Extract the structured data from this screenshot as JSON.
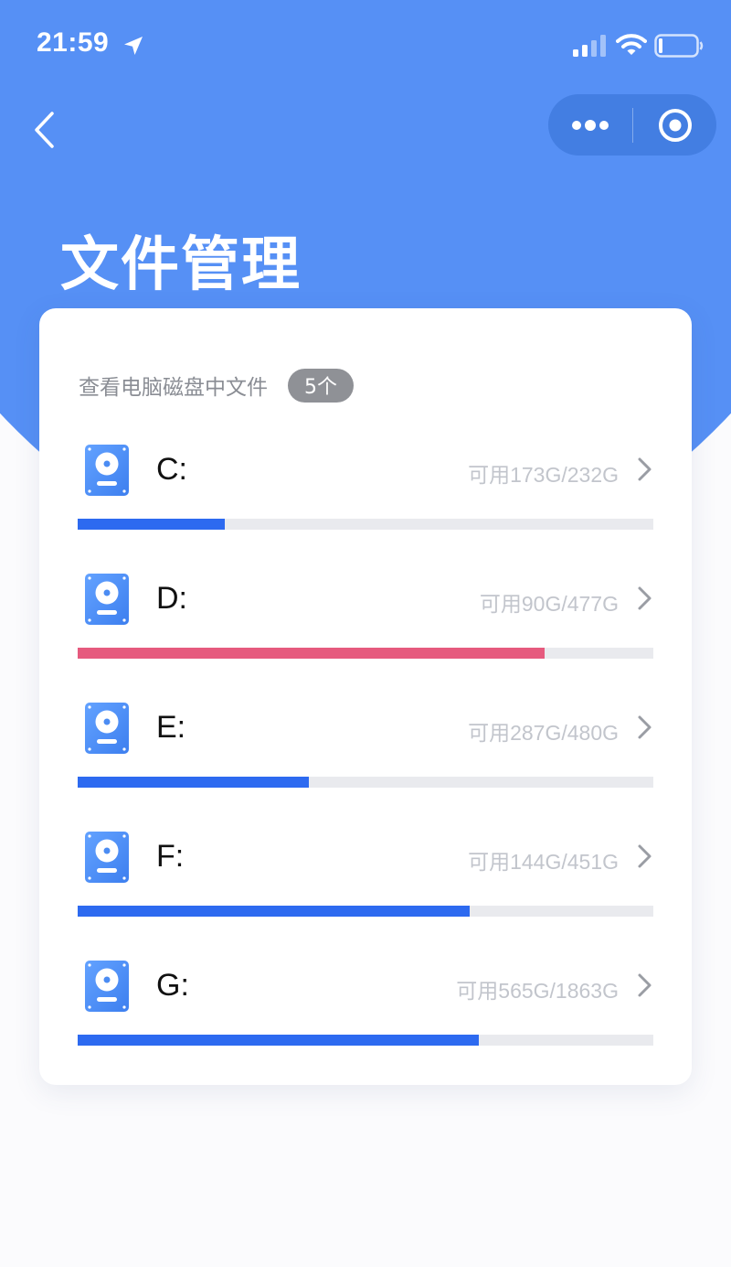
{
  "status_bar": {
    "time": "21:59",
    "icons": [
      "location-arrow-icon",
      "cellular-signal-icon",
      "wifi-icon",
      "battery-icon"
    ]
  },
  "nav": {
    "back_icon": "chevron-left-icon",
    "capsule_icons": [
      "more-dots-icon",
      "target-close-icon"
    ]
  },
  "page": {
    "title": "文件管理"
  },
  "card": {
    "subtitle": "查看电脑磁盘中文件",
    "count_badge": "5个"
  },
  "colors": {
    "primary": "#5690f5",
    "bar_blue": "#2d6af0",
    "bar_warning": "#e65a7e",
    "track": "#e9eaee"
  },
  "disks": [
    {
      "name": "C:",
      "usage": "可用173G/232G",
      "used_fraction": 0.255,
      "bar_color": "#2d6af0"
    },
    {
      "name": "D:",
      "usage": "可用90G/477G",
      "used_fraction": 0.811,
      "bar_color": "#e65a7e"
    },
    {
      "name": "E:",
      "usage": "可用287G/480G",
      "used_fraction": 0.402,
      "bar_color": "#2d6af0"
    },
    {
      "name": "F:",
      "usage": "可用144G/451G",
      "used_fraction": 0.681,
      "bar_color": "#2d6af0"
    },
    {
      "name": "G:",
      "usage": "可用565G/1863G",
      "used_fraction": 0.697,
      "bar_color": "#2d6af0"
    }
  ]
}
